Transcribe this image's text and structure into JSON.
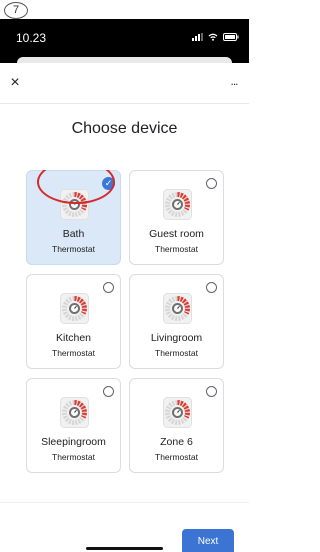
{
  "step_label": "7",
  "status_bar": {
    "time": "10.23"
  },
  "header": {
    "close_icon": "×",
    "more_icon": "..."
  },
  "title": "Choose device",
  "devices": [
    {
      "name": "Bath",
      "type": "Thermostat",
      "selected": true
    },
    {
      "name": "Guest room",
      "type": "Thermostat",
      "selected": false
    },
    {
      "name": "Kitchen",
      "type": "Thermostat",
      "selected": false
    },
    {
      "name": "Livingroom",
      "type": "Thermostat",
      "selected": false
    },
    {
      "name": "Sleepingroom",
      "type": "Thermostat",
      "selected": false
    },
    {
      "name": "Zone 6",
      "type": "Thermostat",
      "selected": false
    },
    {
      "name": "",
      "type": "",
      "selected": false
    },
    {
      "name": "",
      "type": "",
      "selected": false
    }
  ],
  "check_icon": "✓",
  "next_label": "Next",
  "colors": {
    "accent": "#3b74d3",
    "selected_card": "#dbe8f7",
    "highlight": "#d42a2a",
    "thermostat_red": "#e03a2f"
  }
}
